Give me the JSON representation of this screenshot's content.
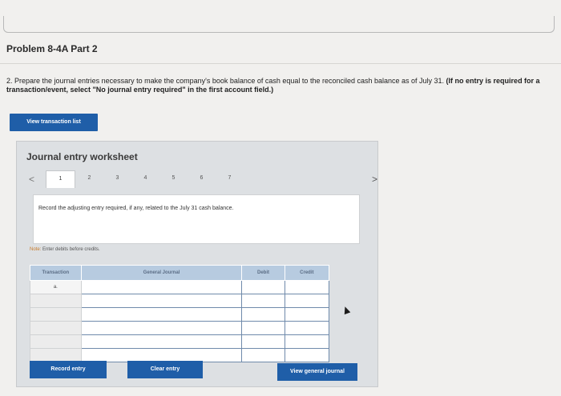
{
  "problem": {
    "title": "Problem 8-4A Part 2",
    "instructions_main": "2. Prepare the journal entries necessary to make the company's book balance of cash equal to the reconciled cash balance as of July 31. ",
    "instructions_bold": "(If no entry is required for a transaction/event, select \"No journal entry required\" in the first account field.)"
  },
  "buttons": {
    "view_transaction_list": "View transaction list",
    "record_entry": "Record entry",
    "clear_entry": "Clear entry",
    "view_general_journal": "View general journal"
  },
  "worksheet": {
    "title": "Journal entry worksheet",
    "prev_arrow": "<",
    "next_arrow": ">",
    "tabs": [
      "1",
      "2",
      "3",
      "4",
      "5",
      "6",
      "7"
    ],
    "active_tab": "1",
    "record_text": "Record the adjusting entry required, if any, related to the July 31 cash balance.",
    "note_label": "Note:",
    "note_text": " Enter debits before credits."
  },
  "table": {
    "headers": {
      "transaction": "Transaction",
      "general_journal": "General Journal",
      "debit": "Debit",
      "credit": "Credit"
    },
    "first_transaction": "a."
  }
}
